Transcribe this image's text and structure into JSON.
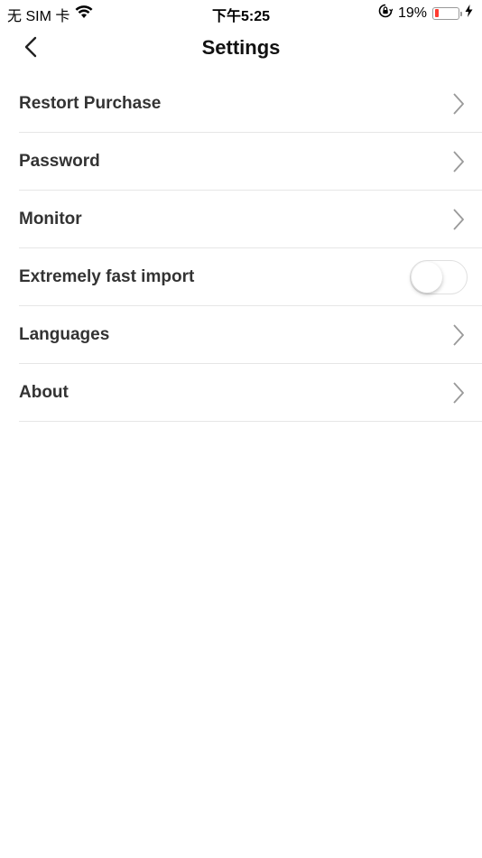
{
  "status_bar": {
    "carrier": "无 SIM 卡",
    "time": "下午5:25",
    "battery_percent": "19%",
    "battery_level": 0.19,
    "icons": [
      "wifi-icon",
      "orientation-lock-icon",
      "battery-icon",
      "charging-bolt-icon"
    ]
  },
  "nav": {
    "title": "Settings",
    "back_icon": "chevron-left-icon"
  },
  "settings": {
    "items": [
      {
        "label": "Restort Purchase",
        "control": "chevron"
      },
      {
        "label": "Password",
        "control": "chevron"
      },
      {
        "label": "Monitor",
        "control": "chevron"
      },
      {
        "label": "Extremely fast import",
        "control": "toggle",
        "enabled": false
      },
      {
        "label": "Languages",
        "control": "chevron"
      },
      {
        "label": "About",
        "control": "chevron"
      }
    ]
  },
  "colors": {
    "battery_low": "#ff3b30",
    "divider": "#e6e6e6",
    "chevron": "#9a9a9a",
    "text": "#333333"
  }
}
